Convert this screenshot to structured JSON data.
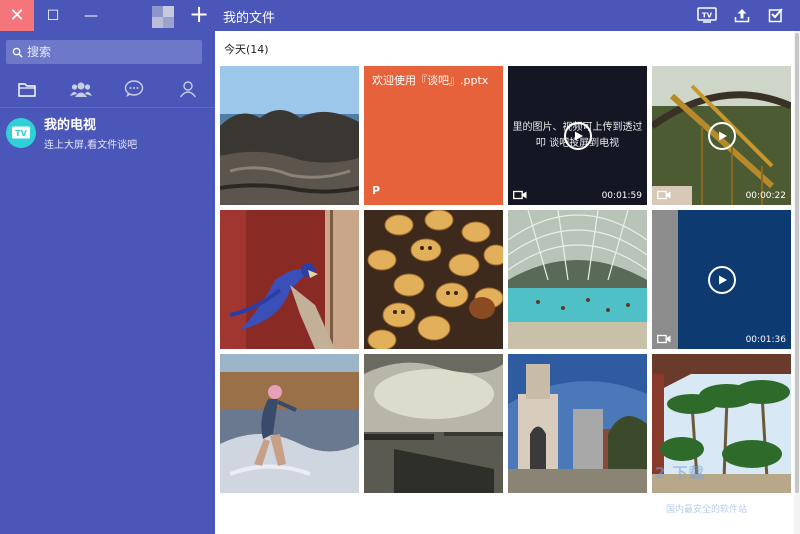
{
  "window": {
    "close_glyph": "✕",
    "maximize_glyph": "☐",
    "minimize_glyph": "—",
    "add_glyph": "+"
  },
  "sidebar": {
    "search_placeholder": "搜索",
    "nav_icons": [
      "folder-icon",
      "group-icon",
      "chat-icon",
      "user-icon"
    ],
    "device": {
      "title": "我的电视",
      "subtitle": "连上大屏,看文件谈吧"
    }
  },
  "topbar": {
    "title": "我的文件",
    "buttons": [
      "tv-icon",
      "upload-icon",
      "select-icon"
    ]
  },
  "main": {
    "section_title": "今天(14)",
    "tiles": [
      {
        "kind": "photo",
        "subject": "rocky-coast"
      },
      {
        "kind": "ppt",
        "title": "欢迎使用『谈吧』.pptx",
        "mark": "P"
      },
      {
        "kind": "video",
        "caption": "里的图片、视频可上传到透过叩 谈吧投屏到电视",
        "duration": "00:01:59"
      },
      {
        "kind": "video",
        "subject": "roller-coaster",
        "duration": "00:00:22"
      },
      {
        "kind": "photo",
        "subject": "parrot-red-door"
      },
      {
        "kind": "photo",
        "subject": "cookies"
      },
      {
        "kind": "photo",
        "subject": "indoor-pool"
      },
      {
        "kind": "video",
        "subject": "blue-screen",
        "duration": "00:01:36"
      },
      {
        "kind": "photo",
        "subject": "beach-girl"
      },
      {
        "kind": "photo",
        "subject": "pier-clouds"
      },
      {
        "kind": "photo",
        "subject": "arch-building"
      },
      {
        "kind": "photo",
        "subject": "palm-trees"
      }
    ]
  },
  "watermark": {
    "line1": "2 下载",
    "line2": "国内最安全的软件站"
  },
  "colors": {
    "sidebar": "#4b57b8",
    "close": "#f4767a",
    "ppt": "#e5623a",
    "tv_badge": "#2fd0d8"
  }
}
